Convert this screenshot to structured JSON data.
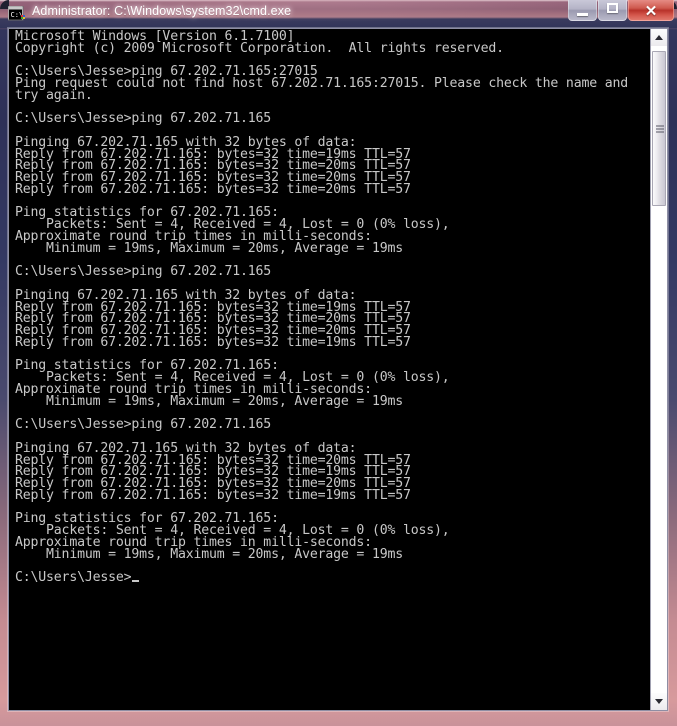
{
  "window": {
    "title": "Administrator: C:\\Windows\\system32\\cmd.exe",
    "icon": "cmd-console-icon",
    "icon_text": "C:\\",
    "border_color": "#b5818f",
    "titlebar_accent": "#96637a"
  },
  "controls": {
    "minimize_label": "",
    "maximize_label": "",
    "close_label": "✕"
  },
  "scrollbar": {
    "up_arrow": "▲",
    "down_arrow": "▼",
    "thumb_position_percent": 3
  },
  "console": {
    "foreground_color": "#c8c8c8",
    "background_color": "#000000",
    "prompt": "C:\\Users\\Jesse>",
    "host": "67.202.71.165",
    "host_with_port": "67.202.71.165:27015",
    "text": "Microsoft Windows [Version 6.1.7100]\nCopyright (c) 2009 Microsoft Corporation.  All rights reserved.\n\nC:\\Users\\Jesse>ping 67.202.71.165:27015\nPing request could not find host 67.202.71.165:27015. Please check the name and\ntry again.\n\nC:\\Users\\Jesse>ping 67.202.71.165\n\nPinging 67.202.71.165 with 32 bytes of data:\nReply from 67.202.71.165: bytes=32 time=19ms TTL=57\nReply from 67.202.71.165: bytes=32 time=20ms TTL=57\nReply from 67.202.71.165: bytes=32 time=20ms TTL=57\nReply from 67.202.71.165: bytes=32 time=20ms TTL=57\n\nPing statistics for 67.202.71.165:\n    Packets: Sent = 4, Received = 4, Lost = 0 (0% loss),\nApproximate round trip times in milli-seconds:\n    Minimum = 19ms, Maximum = 20ms, Average = 19ms\n\nC:\\Users\\Jesse>ping 67.202.71.165\n\nPinging 67.202.71.165 with 32 bytes of data:\nReply from 67.202.71.165: bytes=32 time=19ms TTL=57\nReply from 67.202.71.165: bytes=32 time=20ms TTL=57\nReply from 67.202.71.165: bytes=32 time=20ms TTL=57\nReply from 67.202.71.165: bytes=32 time=19ms TTL=57\n\nPing statistics for 67.202.71.165:\n    Packets: Sent = 4, Received = 4, Lost = 0 (0% loss),\nApproximate round trip times in milli-seconds:\n    Minimum = 19ms, Maximum = 20ms, Average = 19ms\n\nC:\\Users\\Jesse>ping 67.202.71.165\n\nPinging 67.202.71.165 with 32 bytes of data:\nReply from 67.202.71.165: bytes=32 time=20ms TTL=57\nReply from 67.202.71.165: bytes=32 time=19ms TTL=57\nReply from 67.202.71.165: bytes=32 time=20ms TTL=57\nReply from 67.202.71.165: bytes=32 time=19ms TTL=57\n\nPing statistics for 67.202.71.165:\n    Packets: Sent = 4, Received = 4, Lost = 0 (0% loss),\nApproximate round trip times in milli-seconds:\n    Minimum = 19ms, Maximum = 20ms, Average = 19ms\n\nC:\\Users\\Jesse>",
    "banner": {
      "os_version": "Microsoft Windows [Version 6.1.7100]",
      "copyright": "Copyright (c) 2009 Microsoft Corporation.  All rights reserved."
    },
    "commands": [
      "ping 67.202.71.165:27015",
      "ping 67.202.71.165",
      "ping 67.202.71.165",
      "ping 67.202.71.165"
    ],
    "error_message": "Ping request could not find host 67.202.71.165:27015. Please check the name and try again.",
    "ping_runs": [
      {
        "header": "Pinging 67.202.71.165 with 32 bytes of data:",
        "bytes": 32,
        "replies_ms": [
          19,
          20,
          20,
          20
        ],
        "ttl": 57,
        "sent": 4,
        "received": 4,
        "lost": 0,
        "loss_percent": 0,
        "minimum_ms": 19,
        "maximum_ms": 20,
        "average_ms": 19
      },
      {
        "header": "Pinging 67.202.71.165 with 32 bytes of data:",
        "bytes": 32,
        "replies_ms": [
          19,
          20,
          20,
          19
        ],
        "ttl": 57,
        "sent": 4,
        "received": 4,
        "lost": 0,
        "loss_percent": 0,
        "minimum_ms": 19,
        "maximum_ms": 20,
        "average_ms": 19
      },
      {
        "header": "Pinging 67.202.71.165 with 32 bytes of data:",
        "bytes": 32,
        "replies_ms": [
          20,
          19,
          20,
          19
        ],
        "ttl": 57,
        "sent": 4,
        "received": 4,
        "lost": 0,
        "loss_percent": 0,
        "minimum_ms": 19,
        "maximum_ms": 20,
        "average_ms": 19
      }
    ]
  }
}
